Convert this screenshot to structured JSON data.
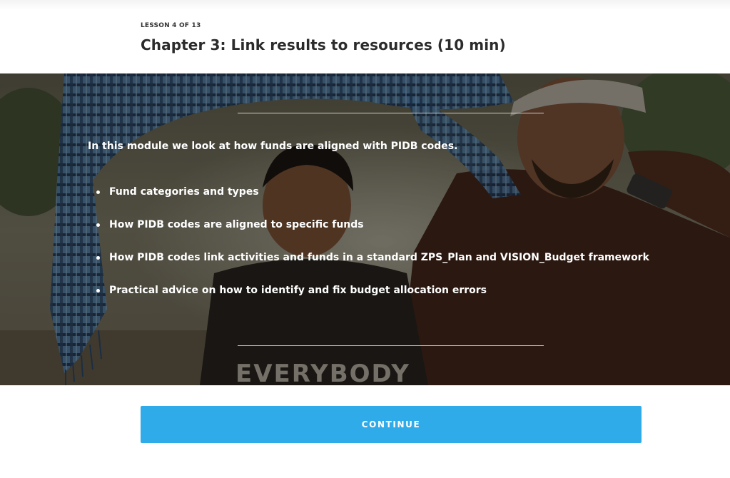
{
  "header": {
    "lesson_count": "LESSON 4 OF 13",
    "title": "Chapter 3: Link results to resources (10 min)"
  },
  "content": {
    "intro": "In this module we look at how funds are aligned with PIDB codes.",
    "topics": [
      "Fund categories and types",
      "How PIDB codes are aligned to specific funds",
      "How PIDB codes link activities and funds in a standard ZPS_Plan and VISION_Budget framework",
      "Practical advice on how to identify and fix budget allocation errors"
    ],
    "image": {
      "shirt_text": "EVERYBODY"
    }
  },
  "actions": {
    "continue_label": "CONTINUE"
  },
  "colors": {
    "accent": "#2fabe9",
    "title_text": "#2b2b2b",
    "overlay_text": "#ffffff"
  }
}
